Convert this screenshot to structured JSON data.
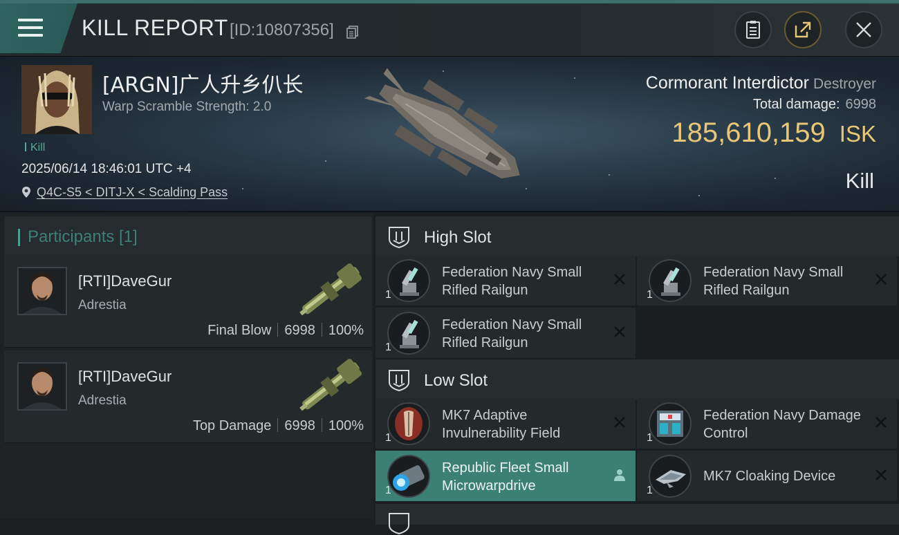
{
  "header": {
    "title": "KILL REPORT",
    "report_id": "[ID:10807356]"
  },
  "victim": {
    "name": "[ARGN]广人升乡仈长",
    "warp_scramble": "Warp Scramble Strength: 2.0",
    "tag": "Kill",
    "datetime": "2025/06/14 18:46:01 UTC +4",
    "location": "Q4C-S5 < DITJ-X < Scalding Pass"
  },
  "ship": {
    "name": "Cormorant Interdictor",
    "class": "Destroyer",
    "total_damage_label": "Total damage:",
    "total_damage_value": "6998",
    "isk_value": "185,610,159",
    "isk_unit": "ISK",
    "kill_type": "Kill"
  },
  "participants": {
    "title": "Participants [1]",
    "items": [
      {
        "name": "[RTI]DaveGur",
        "corp": "Adrestia",
        "role": "Final Blow",
        "damage": "6998",
        "percent": "100%"
      },
      {
        "name": "[RTI]DaveGur",
        "corp": "Adrestia",
        "role": "Top Damage",
        "damage": "6998",
        "percent": "100%"
      }
    ]
  },
  "fittings": {
    "high_slot": {
      "title": "High Slot",
      "modules": [
        {
          "name": "Federation Navy Small Rifled Railgun",
          "qty": "1",
          "icon": "railgun-icon",
          "action": "destroyed"
        },
        {
          "name": "Federation Navy Small Rifled Railgun",
          "qty": "1",
          "icon": "railgun-icon",
          "action": "destroyed"
        },
        {
          "name": "Federation Navy Small Rifled Railgun",
          "qty": "1",
          "icon": "railgun-icon",
          "action": "destroyed"
        }
      ]
    },
    "low_slot": {
      "title": "Low Slot",
      "modules": [
        {
          "name": "MK7 Adaptive Invulnerability Field",
          "qty": "1",
          "icon": "shield-field-icon",
          "action": "destroyed"
        },
        {
          "name": "Federation Navy Damage Control",
          "qty": "1",
          "icon": "damage-control-icon",
          "action": "destroyed"
        },
        {
          "name": "Republic Fleet Small Microwarpdrive",
          "qty": "1",
          "icon": "microwarpdrive-icon",
          "action": "dropped"
        },
        {
          "name": "MK7 Cloaking Device",
          "qty": "1",
          "icon": "cloaking-device-icon",
          "action": "destroyed"
        }
      ]
    }
  },
  "colors": {
    "accent_teal": "#3e7f77",
    "isk_gold": "#e9c776",
    "active_module": "#3b8073"
  }
}
